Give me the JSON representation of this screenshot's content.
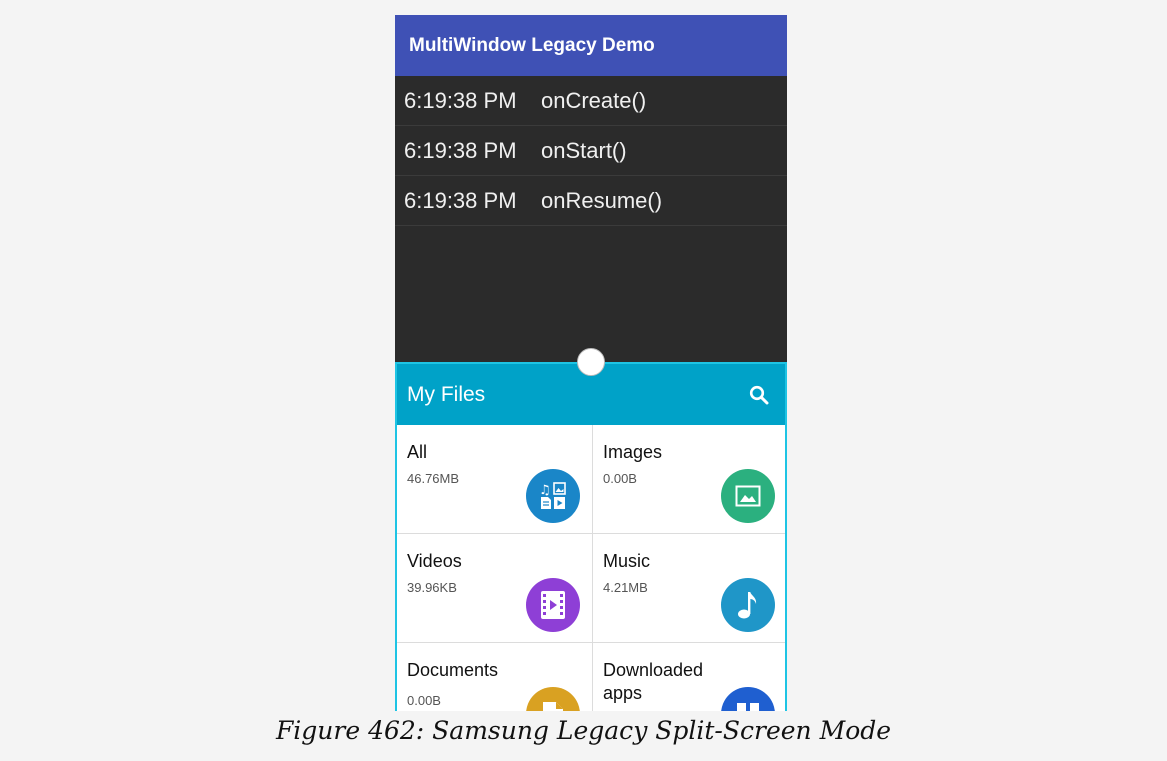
{
  "app": {
    "title": "MultiWindow Legacy Demo"
  },
  "log": [
    {
      "time": "6:19:38 PM",
      "event": "onCreate()"
    },
    {
      "time": "6:19:38 PM",
      "event": "onStart()"
    },
    {
      "time": "6:19:38 PM",
      "event": "onResume()"
    }
  ],
  "files": {
    "title": "My Files",
    "categories": [
      {
        "name": "All",
        "size": "46.76MB",
        "icon": "all-files-icon",
        "color": "#1a86c8"
      },
      {
        "name": "Images",
        "size": "0.00B",
        "icon": "image-icon",
        "color": "#2bb07f"
      },
      {
        "name": "Videos",
        "size": "39.96KB",
        "icon": "video-icon",
        "color": "#8e3fd6"
      },
      {
        "name": "Music",
        "size": "4.21MB",
        "icon": "music-note-icon",
        "color": "#1f96c8"
      },
      {
        "name": "Documents",
        "size": "0.00B",
        "icon": "document-icon",
        "color": "#d9a122"
      },
      {
        "name": "Downloaded apps",
        "size": "",
        "icon": "apps-icon",
        "color": "#1f5fd0"
      }
    ]
  },
  "caption": "Figure 462: Samsung Legacy Split-Screen Mode"
}
